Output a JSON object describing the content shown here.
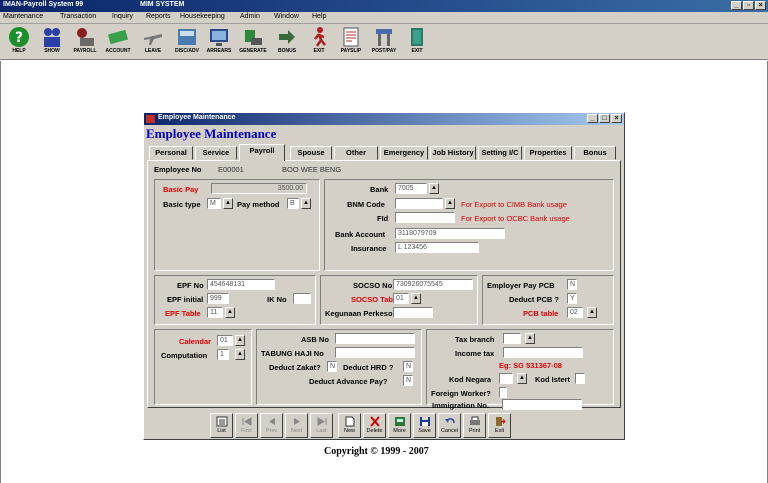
{
  "app": {
    "title": "IMAN-Payroll System 99",
    "subtitle": "MIM SYSTEM",
    "copyright": "Copyright © 1999 - 2007"
  },
  "menu": [
    "Maintenance",
    "Transaction",
    "Inquiry",
    "Reports",
    "Housekeeping",
    "Admin",
    "Window",
    "Help"
  ],
  "toolbar": [
    "HELP",
    "SHOW",
    "PAYROLL",
    "ACCOUNT",
    "LEAVE",
    "DISC/ADV",
    "ARREARS",
    "GENERATE",
    "BONUS",
    "EXIT",
    "PAYSLIP",
    "POST/PAY",
    "EXIT"
  ],
  "dialog": {
    "title": "Employee Maintenance",
    "heading": "Employee Maintenance",
    "tabs": [
      "Personal",
      "Service",
      "Payroll",
      "Spouse",
      "Other",
      "Emergency",
      "Job History",
      "Setting I/C",
      "Properties",
      "Bonus"
    ],
    "active_tab": "Payroll",
    "employee": {
      "label": "Employee No",
      "no": "E00001",
      "name": "BOO WEE BENG"
    },
    "pay": {
      "basic_pay_label": "Basic Pay",
      "basic_pay": "3500.00",
      "basic_type_label": "Basic type",
      "basic_type": "M",
      "pay_method_label": "Pay method",
      "pay_method": "B"
    },
    "bank": {
      "bank_label": "Bank",
      "bank": "7005",
      "bnm_label": "BNM Code",
      "bnm": "",
      "fid_label": "FId",
      "fid": "",
      "cimb_note": "For Export to CIMB Bank usage",
      "ocbc_note": "For Export to OCBC Bank usage",
      "account_label": "Bank Account",
      "account": "3118079709",
      "insurance_label": "Insurance",
      "insurance": "L 123456"
    },
    "epf": {
      "no_label": "EPF No",
      "no": "454648131",
      "initial_label": "EPF initial",
      "initial": "999",
      "ik_label": "IK No",
      "ik": "",
      "table_label": "EPF Table",
      "table": "11"
    },
    "socso": {
      "no_label": "SOCSO No",
      "no": "730926075545",
      "table_label": "SOCSO Table",
      "table": "01",
      "kegunaan_label": "Kegunaan Perkeso",
      "kegunaan": ""
    },
    "pcb": {
      "employer_label": "Employer Pay PCB",
      "employer": "N",
      "deduct_label": "Deduct PCB ?",
      "deduct": "Y",
      "table_label": "PCB table",
      "table": "02"
    },
    "calendar": {
      "calendar_label": "Calendar",
      "calendar": "01",
      "computation_label": "Computation",
      "computation": "1"
    },
    "asb": {
      "asb_label": "ASB No",
      "asb": "",
      "haji_label": "TABUNG HAJI No",
      "haji": "",
      "zakat_label": "Deduct Zakat?",
      "zakat": "N",
      "hrd_label": "Deduct HRD ?",
      "hrd": "N",
      "advance_label": "Deduct Advance Pay?",
      "advance": "N"
    },
    "tax": {
      "branch_label": "Tax branch",
      "branch": "",
      "income_label": "Income tax",
      "income": "",
      "example": "Eg: SG   531367-08",
      "negara_label": "Kod Negara",
      "negara": "",
      "istert_label": "Kod Istert",
      "istert": "",
      "foreign_label": "Foreign Worker?",
      "foreign": "",
      "immigration_label": "Immigration No.",
      "immigration": ""
    },
    "buttons": [
      "List",
      "First",
      "Prev",
      "Next",
      "Last",
      "New",
      "Delete",
      "More",
      "Save",
      "Cancel",
      "Print",
      "Exit"
    ]
  }
}
